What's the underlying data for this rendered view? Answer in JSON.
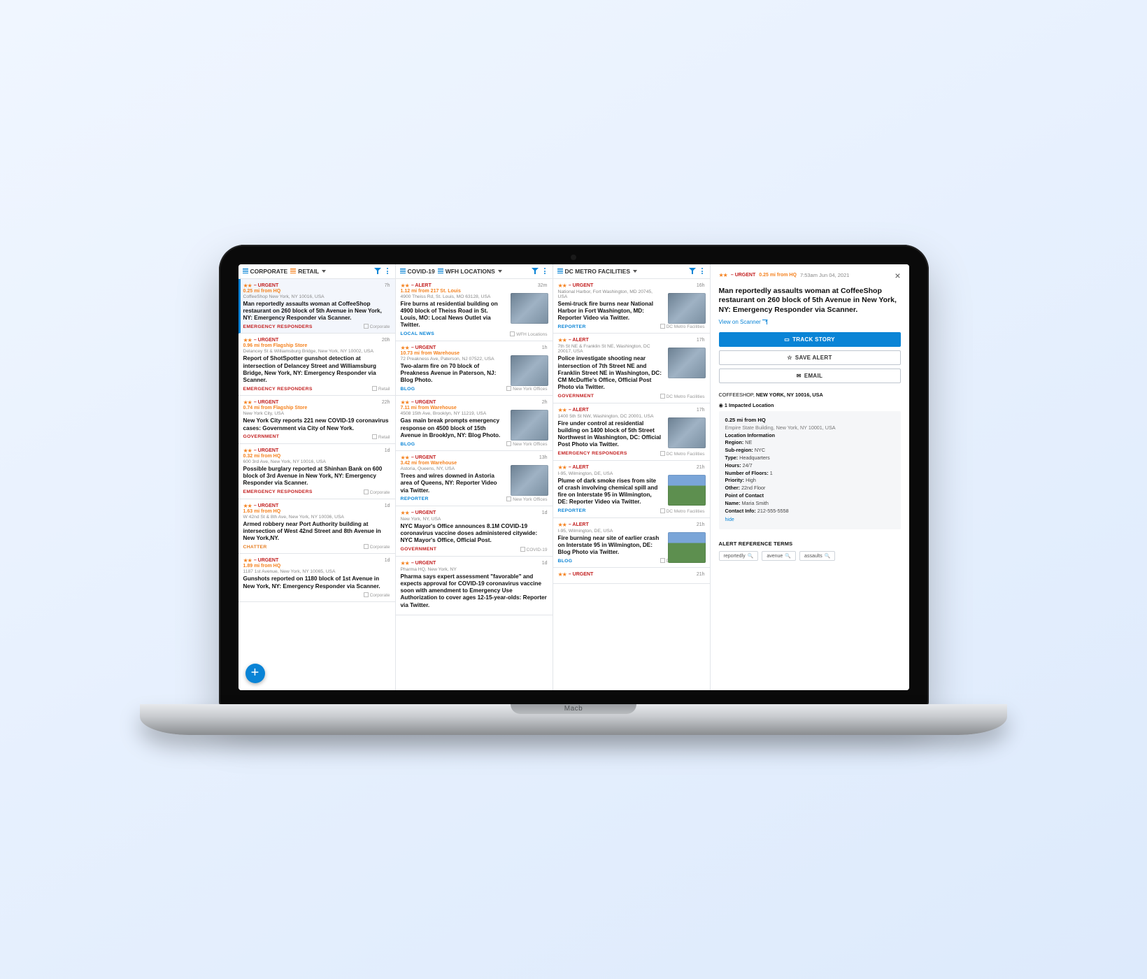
{
  "laptop_brand": "Macb",
  "columns": [
    {
      "tabs": [
        {
          "icon": "blue",
          "label": "CORPORATE"
        },
        {
          "icon": "orange",
          "label": "RETAIL"
        }
      ],
      "cards": [
        {
          "selected": true,
          "stars": "★★",
          "severity": "URGENT",
          "distance": "0.25 mi from HQ",
          "time": "7h",
          "location": "CoffeeShop New York, NY 10016, USA",
          "headline": "Man reportedly assaults woman at CoffeeShop restaurant on 260 block of 5th Avenue in New York, NY: Emergency Responder via Scanner.",
          "source": "EMERGENCY RESPONDERS",
          "source_color": "src-red",
          "tag": "Corporate"
        },
        {
          "stars": "★★",
          "severity": "URGENT",
          "distance": "0.96 mi from Flagship Store",
          "time": "20h",
          "location": "Delancey St & Williamsburg Bridge, New York, NY 10002, USA",
          "headline": "Report of ShotSpotter gunshot detection at intersection of Delancey Street and Williamsburg Bridge, New York, NY: Emergency Responder via Scanner.",
          "source": "EMERGENCY RESPONDERS",
          "source_color": "src-red",
          "tag": "Retail"
        },
        {
          "stars": "★★",
          "severity": "URGENT",
          "distance": "0.74 mi from Flagship Store",
          "time": "22h",
          "location": "New York City, USA",
          "headline": "New York City reports 221 new COVID-19 coronavirus cases: Government via City of New York.",
          "source": "GOVERNMENT",
          "source_color": "src-red",
          "tag": "Retail"
        },
        {
          "stars": "★★",
          "severity": "URGENT",
          "distance": "0.32 mi from HQ",
          "time": "1d",
          "location": "600 3rd Ave, New York, NY 10016, USA",
          "headline": "Possible burglary reported at Shinhan Bank on 600 block of 3rd Avenue in New York, NY: Emergency Responder via Scanner.",
          "source": "EMERGENCY RESPONDERS",
          "source_color": "src-red",
          "tag": "Corporate"
        },
        {
          "stars": "★★",
          "severity": "URGENT",
          "distance": "1.63 mi from HQ",
          "time": "1d",
          "location": "W 42nd St & 8th Ave, New York, NY 10036, USA",
          "headline": "Armed robbery near Port Authority building at intersection of West 42nd Street and 8th Avenue in New York,NY.",
          "source": "CHATTER",
          "source_color": "src-orange",
          "tag": "Corporate"
        },
        {
          "stars": "★★",
          "severity": "URGENT",
          "distance": "1.89 mi from HQ",
          "time": "1d",
          "location": "1187 1st Avenue, New York, NY 10065, USA",
          "headline": "Gunshots reported on 1180 block of 1st Avenue in New York, NY: Emergency Responder via Scanner.",
          "source": "",
          "source_color": "src-red",
          "tag": "Corporate"
        }
      ]
    },
    {
      "tabs": [
        {
          "icon": "blue",
          "label": "COVID-19"
        },
        {
          "icon": "blue",
          "label": "WFH LOCATIONS"
        }
      ],
      "cards": [
        {
          "stars": "★★",
          "severity": "ALERT",
          "distance": "1.12 mi from 217 St. Louis",
          "time": "32m",
          "location": "4900 Theiss Rd, St. Louis, MO 63128, USA",
          "headline": "Fire burns at residential building on 4900 block of Theiss Road in St. Louis, MO: Local News Outlet via Twitter.",
          "source": "LOCAL NEWS",
          "source_color": "src-blue",
          "tag": "WFH Locations",
          "thumb": true
        },
        {
          "stars": "★★",
          "severity": "URGENT",
          "distance": "10.73 mi from Warehouse",
          "time": "1h",
          "location": "72 Preakness Ave, Paterson, NJ 07522, USA",
          "headline": "Two-alarm fire on 70 block of Preakness Avenue in Paterson, NJ: Blog Photo.",
          "source": "BLOG",
          "source_color": "src-blue",
          "tag": "New York Offices",
          "thumb": true
        },
        {
          "stars": "★★",
          "severity": "URGENT",
          "distance": "7.11 mi from Warehouse",
          "time": "2h",
          "location": "4508 15th Ave, Brooklyn, NY 11219, USA",
          "headline": "Gas main break prompts emergency response on 4500 block of 15th Avenue in Brooklyn, NY: Blog Photo.",
          "source": "BLOG",
          "source_color": "src-blue",
          "tag": "New York Offices",
          "thumb": true
        },
        {
          "stars": "★★",
          "severity": "URGENT",
          "distance": "3.42 mi from Warehouse",
          "time": "13h",
          "location": "Astoria, Queens, NY, USA",
          "headline": "Trees and wires downed in Astoria area of Queens, NY: Reporter Video via Twitter.",
          "source": "REPORTER",
          "source_color": "src-blue",
          "tag": "New York Offices",
          "thumb": true
        },
        {
          "stars": "★★",
          "severity": "URGENT",
          "distance": "",
          "time": "1d",
          "location": "New York, NY, USA",
          "headline": "NYC Mayor's Office announces 8.1M COVID-19 coronavirus vaccine doses administered citywide: NYC Mayor's Office, Official Post.",
          "source": "GOVERNMENT",
          "source_color": "src-red",
          "tag": "COVID-19"
        },
        {
          "stars": "★★",
          "severity": "URGENT",
          "distance": "",
          "time": "1d",
          "location": "Pharma HQ, New York, NY",
          "headline": "Pharma says expert assessment \"favorable\" and expects approval for COVID-19 coronavirus vaccine soon with amendment to Emergency Use Authorization to cover ages 12-15-year-olds: Reporter via Twitter.",
          "source": "",
          "source_color": "src-blue",
          "tag": ""
        }
      ]
    },
    {
      "tabs": [
        {
          "icon": "blue",
          "label": "DC METRO FACILITIES"
        }
      ],
      "cards": [
        {
          "stars": "★★",
          "severity": "URGENT",
          "distance": "",
          "time": "16h",
          "location": "National Harbor, Fort Washington, MD 20745, USA",
          "headline": "Semi-truck fire burns near National Harbor in Fort Washington, MD:  Reporter Video via Twitter.",
          "source": "REPORTER",
          "source_color": "src-blue",
          "tag": "DC Metro Facilities",
          "thumb": true
        },
        {
          "stars": "★★",
          "severity": "ALERT",
          "distance": "",
          "time": "17h",
          "location": "7th St NE & Franklin St NE, Washington, DC 20017, USA",
          "headline": "Police investigate shooting near intersection of 7th Street NE and Franklin Street NE in Washington, DC: CM McDuffie's Office, Official Post Photo via Twitter.",
          "source": "GOVERNMENT",
          "source_color": "src-red",
          "tag": "DC Metro Facilities",
          "thumb": true
        },
        {
          "stars": "★★",
          "severity": "ALERT",
          "distance": "",
          "time": "17h",
          "location": "1400 5th St NW, Washington, DC 20001, USA",
          "headline": "Fire under control at residential building on 1400 block of 5th Street Northwest in Washington, DC: Official Post Photo via Twitter.",
          "source": "EMERGENCY RESPONDERS",
          "source_color": "src-red",
          "tag": "DC Metro Facilities",
          "thumb": true
        },
        {
          "stars": "★★",
          "severity": "ALERT",
          "distance": "",
          "time": "21h",
          "location": "I-95, Wilmington, DE, USA",
          "headline": "Plume of dark smoke rises from site of crash involving chemical spill and fire on Interstate 95 in Wilmington, DE: Reporter Video via Twitter.",
          "source": "REPORTER",
          "source_color": "src-blue",
          "tag": "DC Metro Facilities",
          "thumb": true,
          "thumb_style": "green"
        },
        {
          "stars": "★★",
          "severity": "ALERT",
          "distance": "",
          "time": "21h",
          "location": "I-95, Wilmington, DE, USA",
          "headline": "Fire burning near site of earlier crash on Interstate 95 in Wilmington, DE: Blog Photo via Twitter.",
          "source": "BLOG",
          "source_color": "src-blue",
          "tag": "DC Metro Facilities",
          "thumb": true,
          "thumb_style": "green"
        },
        {
          "stars": "★★",
          "severity": "URGENT",
          "distance": "",
          "time": "21h",
          "location": "",
          "headline": "",
          "source": "",
          "source_color": "",
          "tag": ""
        }
      ]
    }
  ],
  "detail": {
    "severity": "URGENT",
    "stars": "★★",
    "distance": "0.25 mi from HQ",
    "timestamp": "7:53am Jun 04, 2021",
    "title": "Man reportedly assaults woman at CoffeeShop restaurant on 260 block of 5th Avenue in New York, NY: Emergency Responder via Scanner.",
    "view_link": "View on Scanner",
    "buttons": {
      "track": "TRACK STORY",
      "save": "SAVE ALERT",
      "email": "EMAIL"
    },
    "breadcrumb_prefix": "COFFEESHOP,",
    "breadcrumb_bold": "NEW YORK, NY 10016, USA",
    "impacted_label": "1 Impacted Location",
    "impact": {
      "title": "0.25 mi from HQ",
      "address": "Empire State Building, New York, NY 10001, USA",
      "info_label": "Location Information",
      "region_k": "Region:",
      "region_v": "NE",
      "subregion_k": "Sub-region:",
      "subregion_v": "NYC",
      "type_k": "Type:",
      "type_v": "Headquarters",
      "hours_k": "Hours:",
      "hours_v": "24/7",
      "floors_k": "Number of Floors:",
      "floors_v": "1",
      "priority_k": "Priority:",
      "priority_v": "High",
      "other_k": "Other:",
      "other_v": "22nd Floor",
      "poc_label": "Point of Contact",
      "name_k": "Name:",
      "name_v": "Maria Smith",
      "contact_k": "Contact Info:",
      "contact_v": "212-555-5558",
      "hide": "hide"
    },
    "ref_heading": "ALERT REFERENCE TERMS",
    "chips": [
      "reportedly",
      "avenue",
      "assaults"
    ]
  }
}
